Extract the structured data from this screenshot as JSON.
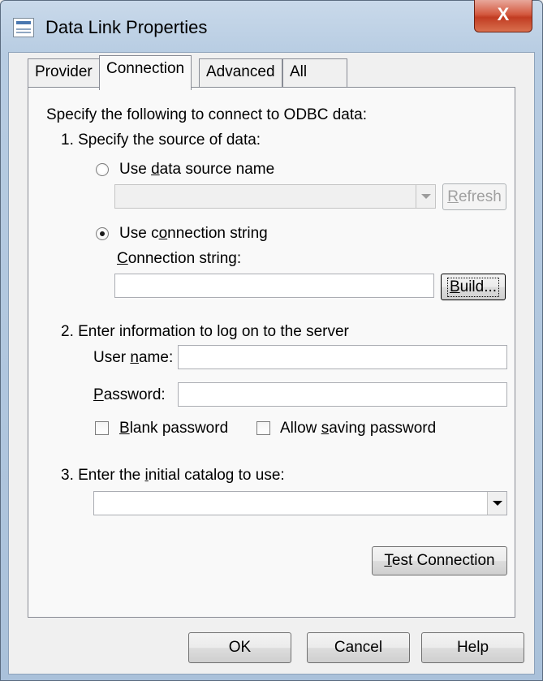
{
  "window": {
    "title": "Data Link Properties",
    "close_label": "X"
  },
  "tabs": [
    {
      "label": "Provider",
      "active": false
    },
    {
      "label": "Connection",
      "active": true
    },
    {
      "label": "Advanced",
      "active": false
    },
    {
      "label": "All",
      "active": false
    }
  ],
  "connection": {
    "intro": "Specify the following to connect to ODBC data:",
    "step1": "1. Specify the source of data:",
    "radio_dsn": {
      "before": "Use ",
      "mnemonic": "d",
      "after": "ata source name",
      "checked": false
    },
    "dsn_value": "",
    "refresh": {
      "mnemonic": "R",
      "after": "efresh",
      "enabled": false
    },
    "radio_connstr": {
      "before": "Use c",
      "mnemonic": "o",
      "after": "nnection string",
      "checked": true
    },
    "connstr_label": {
      "mnemonic": "C",
      "after": "onnection string:"
    },
    "connstr_value": "",
    "build": {
      "mnemonic": "B",
      "after": "uild..."
    },
    "step2": "2. Enter information to log on to the server",
    "username_label": {
      "before": "User ",
      "mnemonic": "n",
      "after": "ame:"
    },
    "username_value": "",
    "password_label": {
      "mnemonic": "P",
      "after": "assword:"
    },
    "password_value": "",
    "blank_password": {
      "mnemonic": "B",
      "after": "lank password",
      "checked": false
    },
    "allow_saving": {
      "before": "Allow ",
      "mnemonic": "s",
      "after": "aving password",
      "checked": false
    },
    "step3": {
      "before": "3. Enter the ",
      "mnemonic": "i",
      "after": "nitial catalog to use:"
    },
    "catalog_value": "",
    "test_connection": {
      "mnemonic": "T",
      "after": "est Connection"
    }
  },
  "footer": {
    "ok": "OK",
    "cancel": "Cancel",
    "help": "Help"
  }
}
